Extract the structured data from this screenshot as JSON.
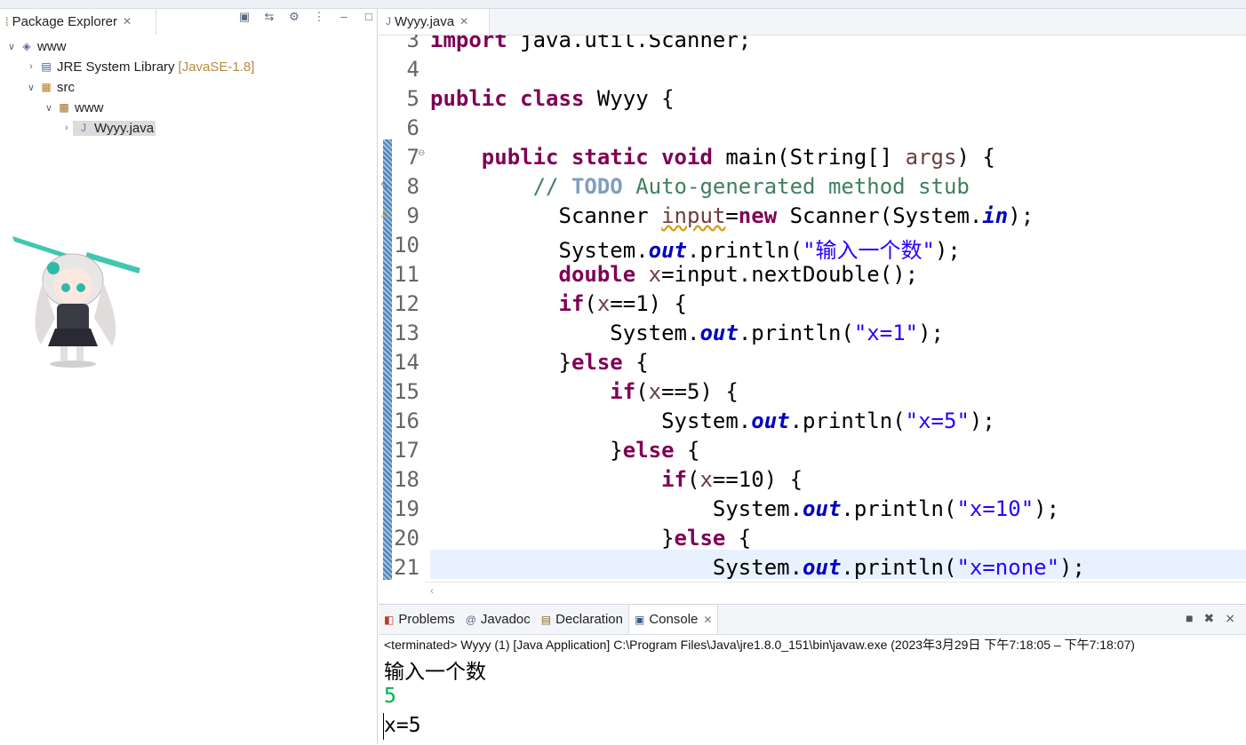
{
  "explorer": {
    "tab_label": "Package Explorer",
    "tree": [
      {
        "label": "www",
        "icon": "java-project-icon"
      },
      {
        "label": "JRE System Library",
        "decoration": "[JavaSE-1.8]",
        "icon": "library-icon"
      },
      {
        "label": "src",
        "icon": "source-folder-icon"
      },
      {
        "label": "www",
        "icon": "package-icon"
      },
      {
        "label": "Wyyy.java",
        "icon": "java-file-icon"
      }
    ]
  },
  "editor": {
    "tab_label": "Wyyy.java",
    "line_numbers": [
      "3",
      "4",
      "5",
      "6",
      "7",
      "8",
      "9",
      "10",
      "11",
      "12",
      "13",
      "14",
      "15",
      "16",
      "17",
      "18",
      "19",
      "20",
      "21"
    ],
    "tokens": {
      "import_kw": "import",
      "import_rest": " java.util.Scanner;",
      "public": "public",
      "class": "class",
      "class_name": " Wyyy {",
      "static": "static",
      "void": "void",
      "main_sig": " main(String[] ",
      "args": "args",
      "main_end": ") {",
      "comment_slashes": "// ",
      "todo": "TODO",
      "comment_text": " Auto-generated method stub",
      "scanner_type": "Scanner ",
      "input_var": "input",
      "eq": "=",
      "new": "new",
      "scanner_ctor": " Scanner(System.",
      "in_field": "in",
      "close_paren_semi": ");",
      "system": "System.",
      "out": "out",
      "println_open": ".println(",
      "str_prompt": "\"输入一个数\"",
      "double": "double",
      "x": "x",
      "next_double": "=input.nextDouble();",
      "if": "if",
      "open_paren": "(",
      "cond_1": "==1) {",
      "cond_5": "==5) {",
      "cond_10": "==10) {",
      "str_x1": "\"x=1\"",
      "str_x5": "\"x=5\"",
      "str_x10": "\"x=10\"",
      "str_none": "\"x=none\"",
      "close_brace": "}",
      "else": "else",
      "open_brace_sp": " {"
    }
  },
  "bottom": {
    "tabs": [
      "Problems",
      "Javadoc",
      "Declaration",
      "Console"
    ],
    "terminated_line": "<terminated> Wyyy (1) [Java Application] C:\\Program Files\\Java\\jre1.8.0_151\\bin\\javaw.exe  (2023年3月29日 下午7:18:05 – 下午7:18:07)",
    "output": [
      "输入一个数",
      "5",
      "x=5"
    ]
  }
}
